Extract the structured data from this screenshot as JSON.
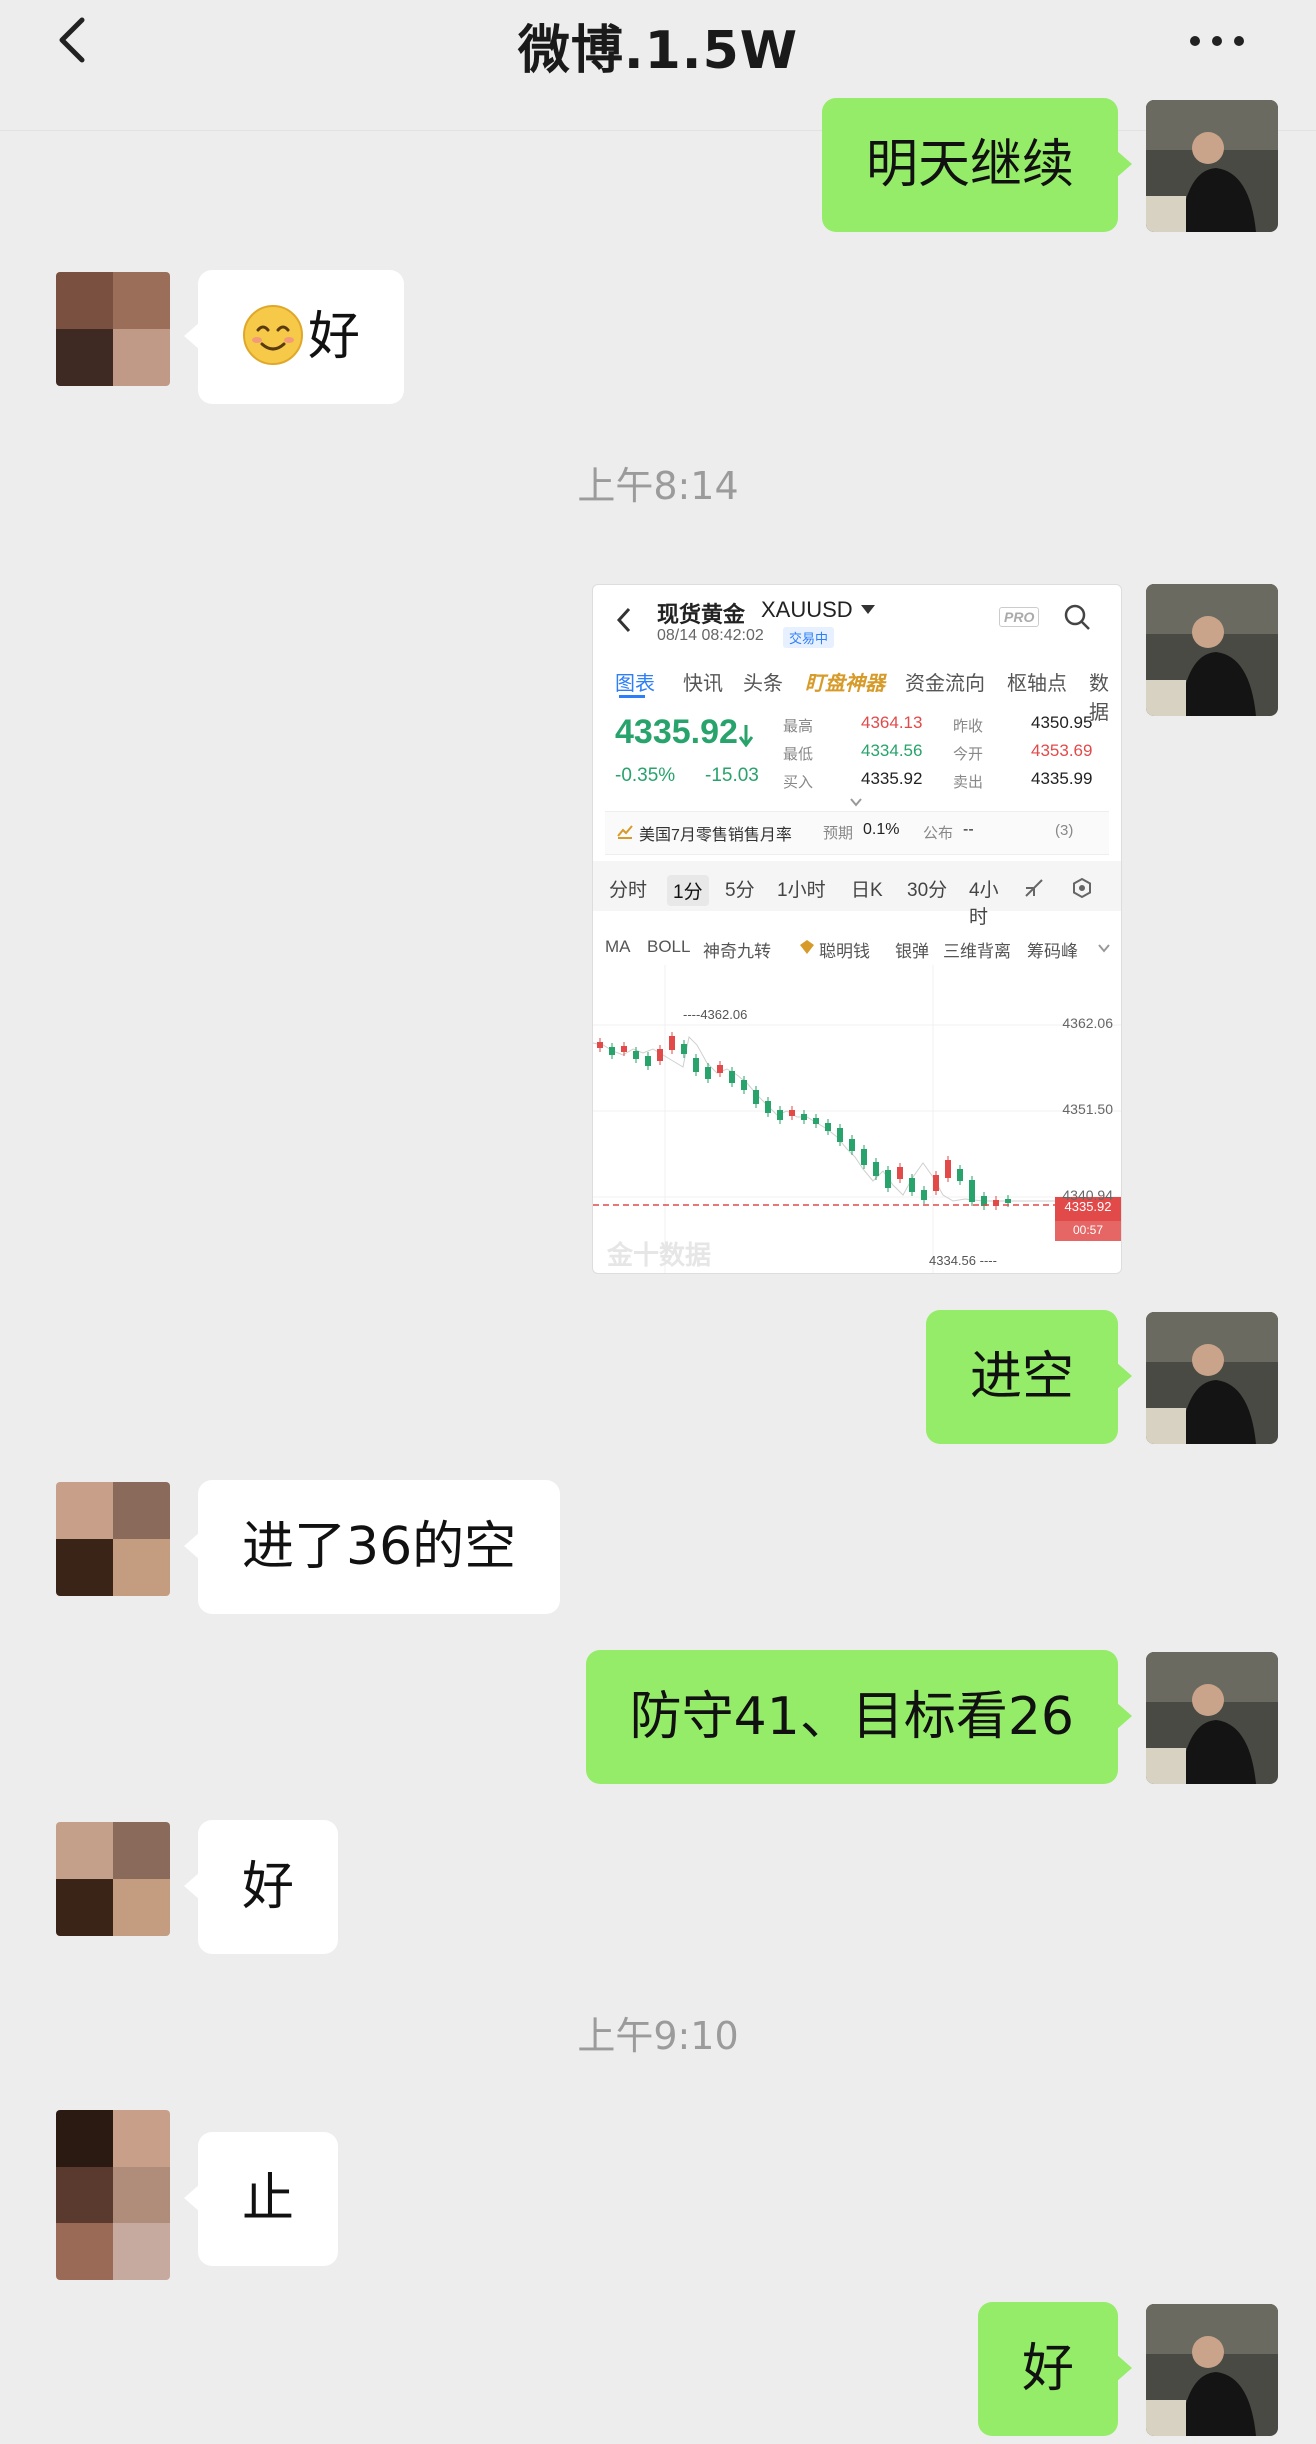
{
  "header": {
    "title": "微博.1.5W",
    "back_icon": "chevron-left-icon",
    "more_icon": "more-dots-icon"
  },
  "messages": {
    "m1": "明天继续",
    "m2_text": "好",
    "m2_emoji": "smiley-icon",
    "ts1": "上午8:14",
    "m4": "进空",
    "m5": "进了36的空",
    "m6": "防守41、目标看26",
    "m7": "好",
    "ts2": "上午9:10",
    "m8": "止",
    "m9": "好"
  },
  "screenshot": {
    "name": "现货黄金",
    "symbol": "XAUUSD",
    "datetime": "08/14 08:42:02",
    "status": "交易中",
    "pro": "PRO",
    "tabs": [
      "图表",
      "快讯",
      "头条",
      "盯盘神器",
      "资金流向",
      "枢轴点",
      "数据"
    ],
    "price": "4335.92",
    "change_pct": "-0.35%",
    "change": "-15.03",
    "stats": {
      "high_label": "最高",
      "high": "4364.13",
      "low_label": "最低",
      "low": "4334.56",
      "buy_label": "买入",
      "buy": "4335.92",
      "prev_label": "昨收",
      "prev": "4350.95",
      "open_label": "今开",
      "open": "4353.69",
      "sell_label": "卖出",
      "sell": "4335.99"
    },
    "event": "美国7月零售销售月率",
    "forecast_label": "预期",
    "forecast": "0.1%",
    "published_label": "公布",
    "published": "--",
    "event_count": "(3)",
    "periods": [
      "分时",
      "1分",
      "5分",
      "1小时",
      "日K",
      "30分",
      "4小时"
    ],
    "indicators": [
      "MA",
      "BOLL",
      "神奇九转",
      "聪明钱",
      "银弹",
      "三维背离",
      "筹码峰"
    ],
    "axis": [
      "4362.06",
      "4351.50",
      "4340.94"
    ],
    "high_mark": "4362.06",
    "low_mark": "4334.56",
    "last_price": "4335.92",
    "countdown": "00:57",
    "watermark": "金十数据",
    "colors": {
      "up": "#e24a4a",
      "down": "#27a36b",
      "accent": "#2d7ff9",
      "gold": "#d79b2a"
    }
  }
}
